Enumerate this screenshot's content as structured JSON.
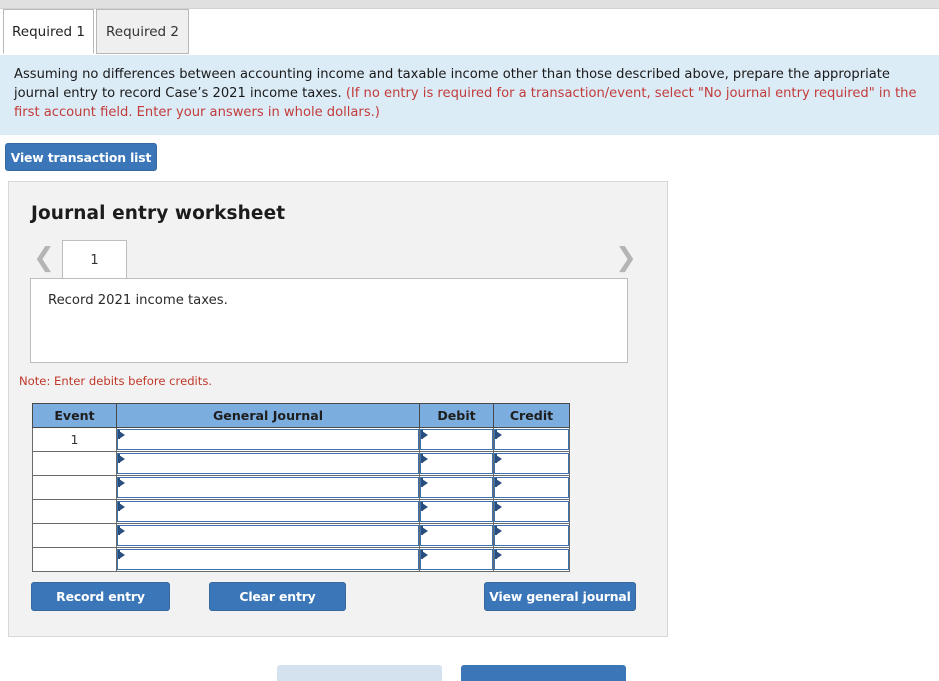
{
  "tabs": [
    {
      "label": "Required 1",
      "active": true
    },
    {
      "label": "Required 2",
      "active": false
    }
  ],
  "banner": {
    "text_main": "Assuming no differences between accounting income and taxable income other than those described above, prepare the appropriate journal entry to record Case’s 2021 income taxes.",
    "text_hint": "(If no entry is required for a transaction/event, select \"No journal entry required\" in the first account field. Enter your answers in whole dollars.)"
  },
  "toolbar": {
    "view_transaction_list_label": "View transaction list"
  },
  "worksheet": {
    "title": "Journal entry worksheet",
    "pager": {
      "prev_icon": "chevron-left-icon",
      "next_icon": "chevron-right-icon",
      "pages": [
        "1"
      ],
      "active_page": "1"
    },
    "description": "Record 2021 income taxes.",
    "note": "Note: Enter debits before credits.",
    "table": {
      "headers": [
        "Event",
        "General Journal",
        "Debit",
        "Credit"
      ],
      "rows": [
        {
          "event": "1",
          "general_journal": "",
          "debit": "",
          "credit": ""
        },
        {
          "event": "",
          "general_journal": "",
          "debit": "",
          "credit": ""
        },
        {
          "event": "",
          "general_journal": "",
          "debit": "",
          "credit": ""
        },
        {
          "event": "",
          "general_journal": "",
          "debit": "",
          "credit": ""
        },
        {
          "event": "",
          "general_journal": "",
          "debit": "",
          "credit": ""
        },
        {
          "event": "",
          "general_journal": "",
          "debit": "",
          "credit": ""
        }
      ]
    },
    "actions": {
      "record_entry_label": "Record entry",
      "clear_entry_label": "Clear entry",
      "view_general_journal_label": "View general journal"
    }
  },
  "colors": {
    "accent_blue": "#3a76b8",
    "table_header_blue": "#7badde",
    "banner_blue": "#dcecf7",
    "hint_red": "#c23b3b",
    "note_red": "#c0392b",
    "panel_gray": "#f2f2f2"
  }
}
